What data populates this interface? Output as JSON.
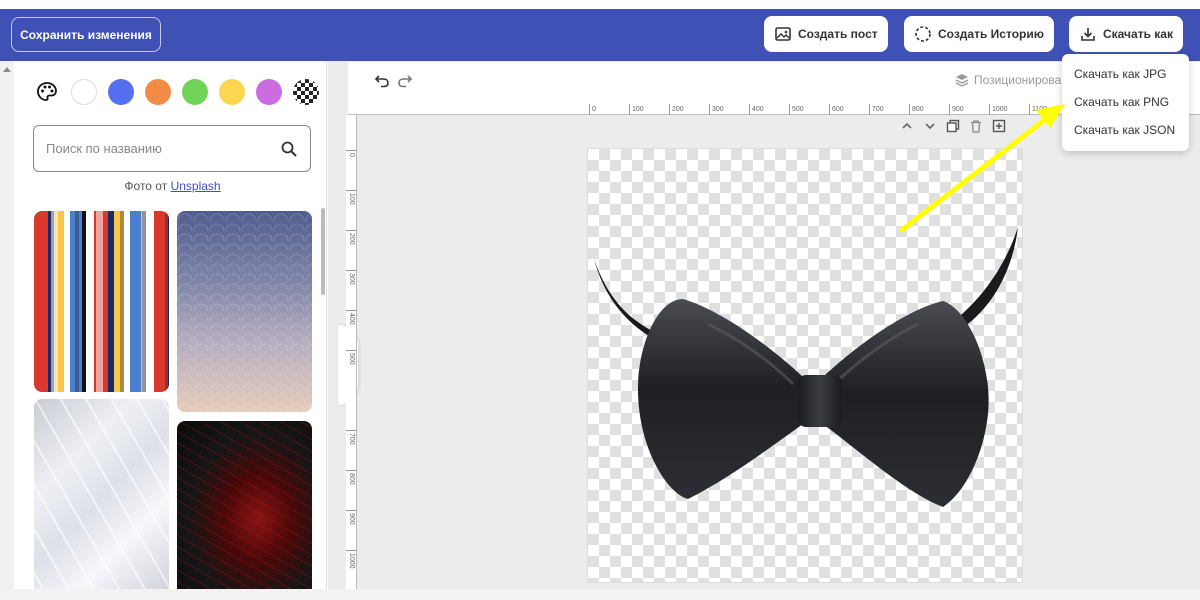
{
  "topbar": {
    "save_label": "Сохранить изменения",
    "create_post_label": "Создать пост",
    "create_story_label": "Создать Историю",
    "download_as_label": "Скачать как"
  },
  "left_panel": {
    "swatches": [
      {
        "name": "white",
        "color": "#ffffff"
      },
      {
        "name": "blue",
        "color": "#5470f0"
      },
      {
        "name": "orange",
        "color": "#f28b46"
      },
      {
        "name": "green",
        "color": "#6fd457"
      },
      {
        "name": "yellow",
        "color": "#fbd651"
      },
      {
        "name": "purple",
        "color": "#cb6de0"
      }
    ],
    "search_placeholder": "Поиск по названию",
    "photo_credit_prefix": "Фото от",
    "photo_credit_link": "Unsplash"
  },
  "canvas": {
    "positioning_label": "Позиционирова",
    "ruler_h": [
      "0",
      "100",
      "200",
      "300",
      "400",
      "500",
      "600",
      "700",
      "800",
      "900",
      "1000",
      "1100"
    ],
    "ruler_v": [
      "0",
      "100",
      "200",
      "300",
      "400",
      "500",
      "600",
      "700",
      "800",
      "900",
      "1000"
    ]
  },
  "download_menu": {
    "items": [
      "Скачать как JPG",
      "Скачать как PNG",
      "Скачать как JSON"
    ]
  },
  "colors": {
    "brand": "#3f51b5",
    "annotation_arrow": "#ffff00"
  }
}
